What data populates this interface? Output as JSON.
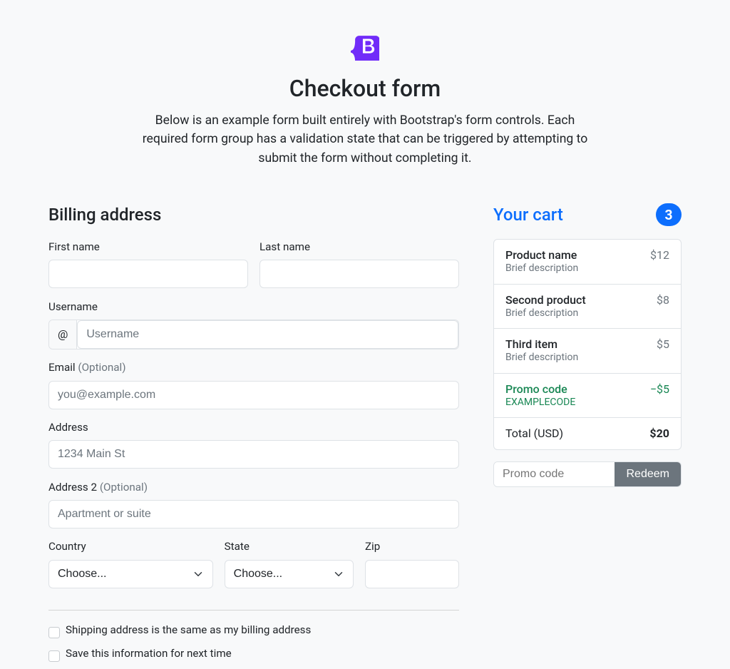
{
  "header": {
    "title": "Checkout form",
    "lead": "Below is an example form built entirely with Bootstrap's form controls. Each required form group has a validation state that can be triggered by attempting to submit the form without completing it."
  },
  "cart": {
    "title": "Your cart",
    "count": "3",
    "items": [
      {
        "name": "Product name",
        "desc": "Brief description",
        "price": "$12"
      },
      {
        "name": "Second product",
        "desc": "Brief description",
        "price": "$8"
      },
      {
        "name": "Third item",
        "desc": "Brief description",
        "price": "$5"
      }
    ],
    "promo": {
      "label": "Promo code",
      "code": "EXAMPLECODE",
      "amount": "−$5"
    },
    "total": {
      "label": "Total (USD)",
      "amount": "$20"
    },
    "redeem": {
      "placeholder": "Promo code",
      "button": "Redeem"
    }
  },
  "billing": {
    "title": "Billing address",
    "labels": {
      "firstName": "First name",
      "lastName": "Last name",
      "username": "Username",
      "usernamePrefix": "@",
      "usernamePlaceholder": "Username",
      "email": "Email",
      "optional": "(Optional)",
      "emailPlaceholder": "you@example.com",
      "address": "Address",
      "addressPlaceholder": "1234 Main St",
      "address2": "Address 2",
      "address2Placeholder": "Apartment or suite",
      "country": "Country",
      "state": "State",
      "zip": "Zip",
      "choose": "Choose...",
      "sameAddress": "Shipping address is the same as my billing address",
      "saveInfo": "Save this information for next time"
    }
  }
}
